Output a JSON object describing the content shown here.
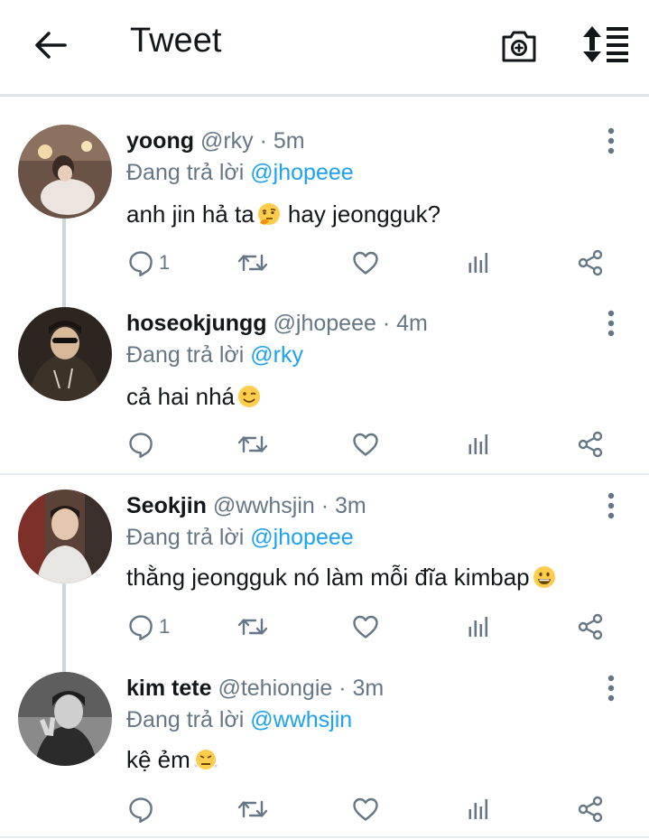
{
  "header": {
    "title": "Tweet"
  },
  "tweets": [
    {
      "name": "yoong",
      "handle": "@rky",
      "time": "5m",
      "reply_prefix": "Đang trả lời",
      "reply_to": "@jhopeee",
      "text": "anh jin hả ta",
      "text_after": " hay jeongguk?",
      "emoji": "thinking-face",
      "reply_count": "1"
    },
    {
      "name": "hoseokjungg",
      "handle": "@jhopeee",
      "time": "4m",
      "reply_prefix": "Đang trả lời",
      "reply_to": "@rky",
      "text": "cả hai nhá",
      "text_after": "",
      "emoji": "winking-face",
      "reply_count": ""
    },
    {
      "name": "Seokjin",
      "handle": "@wwhsjin",
      "time": "3m",
      "reply_prefix": "Đang trả lời",
      "reply_to": "@jhopeee",
      "text": "thằng jeongguk nó làm mỗi đĩa kimbap",
      "text_after": "",
      "emoji": "grinning-face",
      "reply_count": "1"
    },
    {
      "name": "kim tete",
      "handle": "@tehiongie",
      "time": "3m",
      "reply_prefix": "Đang trả lời",
      "reply_to": "@wwhsjin",
      "text": "kệ ẻm",
      "text_after": "",
      "emoji": "face-with-steam",
      "reply_count": ""
    }
  ],
  "separator": "·",
  "colors": {
    "link": "#1da1f2",
    "secondary": "#657786",
    "text": "#14171a",
    "thread_line": "#ccd6dd",
    "divider": "#e6ecf0"
  },
  "icons": [
    "back-arrow-icon",
    "camera-plus-icon",
    "sort-icon",
    "more-vertical-icon",
    "reply-icon",
    "retweet-icon",
    "like-icon",
    "analytics-icon",
    "share-icon"
  ]
}
